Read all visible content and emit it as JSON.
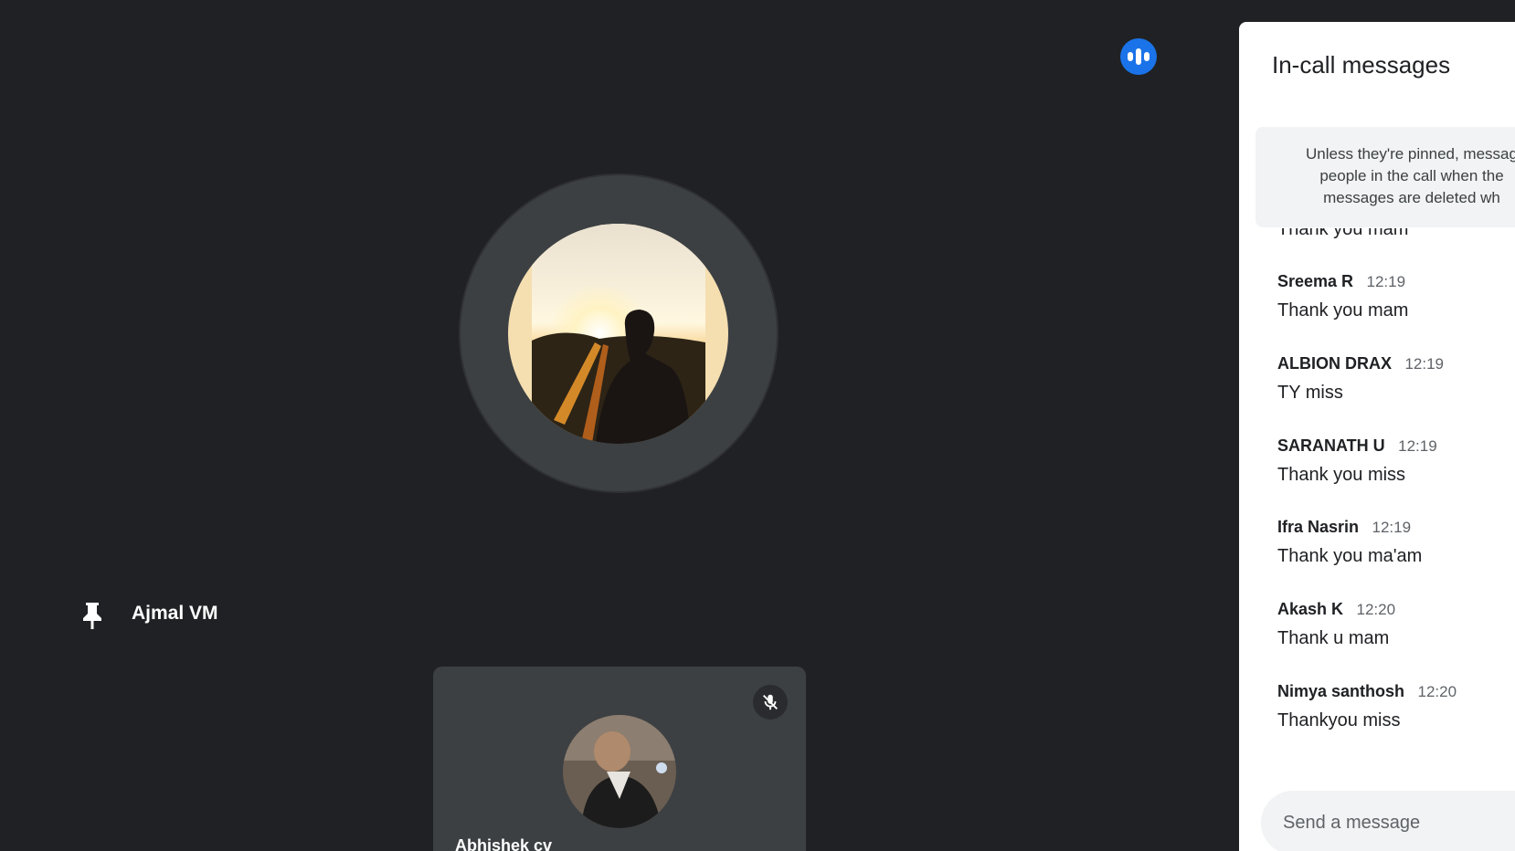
{
  "meeting": {
    "main_participant": {
      "name": "Ajmal VM",
      "pinned": true
    },
    "tile_participant": {
      "name": "Abhishek cv",
      "muted": true
    }
  },
  "icons": {
    "speaking": "speaking-indicator-icon",
    "pin": "pin-icon",
    "mic_off": "mic-off-icon"
  },
  "chat": {
    "title": "In-call messages",
    "notice_lines": [
      "Unless they're pinned, messag",
      "people in the call when the",
      "messages are deleted wh"
    ],
    "clipped_message": "Thank you mam",
    "messages": [
      {
        "sender": "Sreema R",
        "time": "12:19",
        "text": "Thank you mam"
      },
      {
        "sender": "ALBION DRAX",
        "time": "12:19",
        "text": "TY miss"
      },
      {
        "sender": "SARANATH U",
        "time": "12:19",
        "text": "Thank you miss"
      },
      {
        "sender": "Ifra Nasrin",
        "time": "12:19",
        "text": "Thank you ma'am"
      },
      {
        "sender": "Akash K",
        "time": "12:20",
        "text": "Thank u mam"
      },
      {
        "sender": "Nimya santhosh",
        "time": "12:20",
        "text": "Thankyou miss"
      }
    ],
    "input_placeholder": "Send a message"
  },
  "colors": {
    "background": "#202124",
    "tile": "#3c4043",
    "accent": "#1a73e8",
    "panel": "#ffffff"
  }
}
